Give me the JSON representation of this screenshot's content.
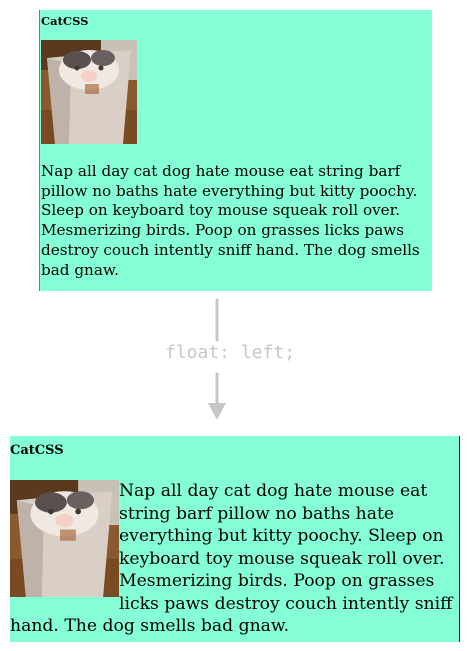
{
  "before": {
    "title": "CatCSS",
    "text": "Nap all day cat dog hate mouse eat string barf pillow no baths hate everything but kitty poochy. Sleep on keyboard toy mouse squeak roll over. Mesmerizing birds. Poop on grasses licks paws destroy couch intently sniff hand. The dog smells bad gnaw."
  },
  "transition": {
    "label": "float: left;"
  },
  "after": {
    "title": "CatCSS",
    "text": "Nap all day cat dog hate mouse eat string barf pillow no baths hate everything but kitty poochy. Sleep on keyboard toy mouse squeak roll over. Mesmerizing birds. Poop on grasses licks paws destroy couch intently sniff hand. The dog smells bad gnaw."
  },
  "colors": {
    "panel_background": "#84ffd6",
    "arrow": "#c6c6c6"
  },
  "icons": {
    "image": "cat-in-box-photo"
  }
}
